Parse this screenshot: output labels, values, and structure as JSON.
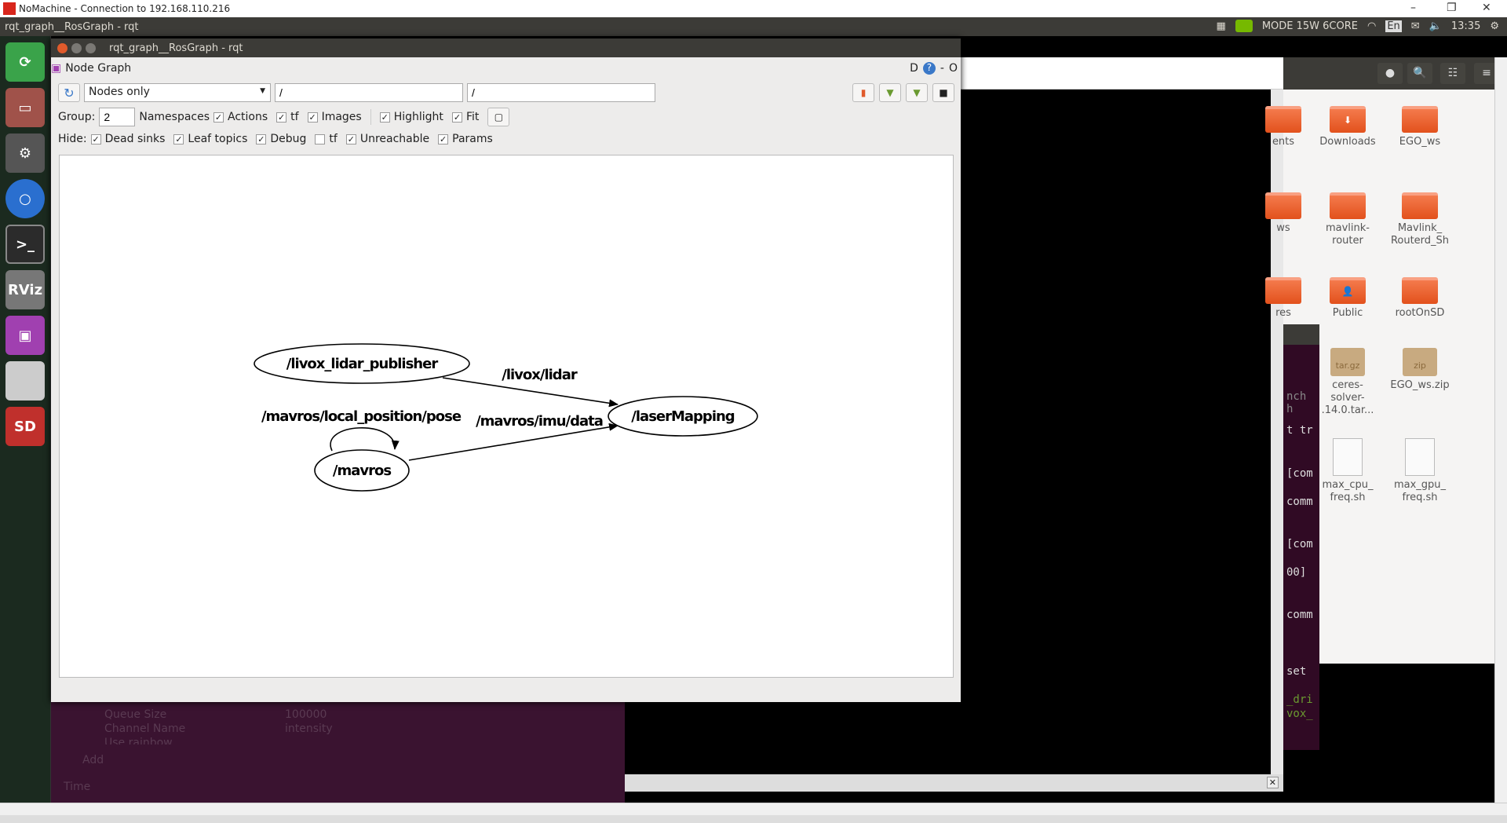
{
  "nomachine": {
    "title": "NoMachine - Connection to 192.168.110.216",
    "logo": "!!!"
  },
  "panel": {
    "app_title": "rqt_graph__RosGraph - rqt",
    "power_mode": "MODE 15W 6CORE",
    "lang": "En",
    "time": "13:35"
  },
  "launcher": {
    "items": [
      {
        "icon": "ubuntu-icon"
      },
      {
        "icon": "files-icon"
      },
      {
        "icon": "settings-icon"
      },
      {
        "icon": "chromium-icon"
      },
      {
        "icon": "terminal-icon",
        "label": ">_"
      },
      {
        "icon": "rviz-icon",
        "label": "RViz"
      },
      {
        "icon": "rqt-icon"
      },
      {
        "icon": "drive-icon"
      },
      {
        "icon": "sd-card-icon",
        "label": "SD"
      }
    ]
  },
  "rqt": {
    "window_title": "rqt_graph__RosGraph - rqt",
    "plugin_title": "Node Graph",
    "plugin_controls": [
      "D",
      "?",
      "-",
      "O"
    ],
    "mode_select": "Nodes only",
    "filter1": "/",
    "filter2": "/",
    "group_label": "Group:",
    "group_value": "2",
    "options": [
      {
        "label": "Namespaces",
        "checked": false,
        "nobox": true
      },
      {
        "label": "Actions",
        "checked": true
      },
      {
        "label": "tf",
        "checked": true
      },
      {
        "label": "Images",
        "checked": true
      },
      {
        "label": "Highlight",
        "checked": true
      },
      {
        "label": "Fit",
        "checked": true
      }
    ],
    "hide_label": "Hide:",
    "hide": [
      {
        "label": "Dead sinks",
        "checked": true
      },
      {
        "label": "Leaf topics",
        "checked": true
      },
      {
        "label": "Debug",
        "checked": true
      },
      {
        "label": "tf",
        "checked": false
      },
      {
        "label": "Unreachable",
        "checked": true
      },
      {
        "label": "Params",
        "checked": true
      }
    ],
    "graph": {
      "nodes": [
        "/livox_lidar_publisher",
        "/laserMapping",
        "/mavros"
      ],
      "edges": [
        {
          "from": "/livox_lidar_publisher",
          "to": "/laserMapping",
          "label": "/livox/lidar"
        },
        {
          "from": "/mavros",
          "to": "/laserMapping",
          "label": "/mavros/imu/data"
        },
        {
          "from": "/mavros",
          "to": "/mavros",
          "label": "/mavros/local_position/pose"
        }
      ]
    }
  },
  "file_manager": {
    "items": [
      {
        "label": "ents",
        "type": "folder"
      },
      {
        "label": "Downloads",
        "type": "folder"
      },
      {
        "label": "EGO_ws",
        "type": "folder"
      },
      {
        "label": "ws",
        "type": "folder"
      },
      {
        "label": "mavlink-\nrouter",
        "type": "folder"
      },
      {
        "label": "Mavlink_\nRouterd_Sh",
        "type": "folder"
      },
      {
        "label": "res",
        "type": "folder"
      },
      {
        "label": "Public",
        "type": "folder"
      },
      {
        "label": "rootOnSD",
        "type": "folder"
      },
      {
        "label": "ceres-\nsolver-\n.14.0.tar...",
        "type": "archive",
        "badge": "tar.gz"
      },
      {
        "label": "EGO_ws.zip",
        "type": "archive",
        "badge": "zip"
      },
      {
        "label": "max_cpu_\nfreq.sh",
        "type": "script"
      },
      {
        "label": "max_gpu_\nfreq.sh",
        "type": "script"
      }
    ]
  },
  "terminal": {
    "title": "nch h",
    "lines": [
      "t tr",
      "[com",
      "comm",
      "[com",
      "00]",
      "comm",
      "set",
      "_dri",
      "vox_"
    ]
  },
  "rviz_panel": {
    "props": [
      {
        "name": "Queue Size",
        "value": "100000"
      },
      {
        "name": "Channel Name",
        "value": "intensity"
      },
      {
        "name": "Use rainbow",
        "value": ""
      }
    ],
    "add": "Add",
    "time": "Time"
  }
}
